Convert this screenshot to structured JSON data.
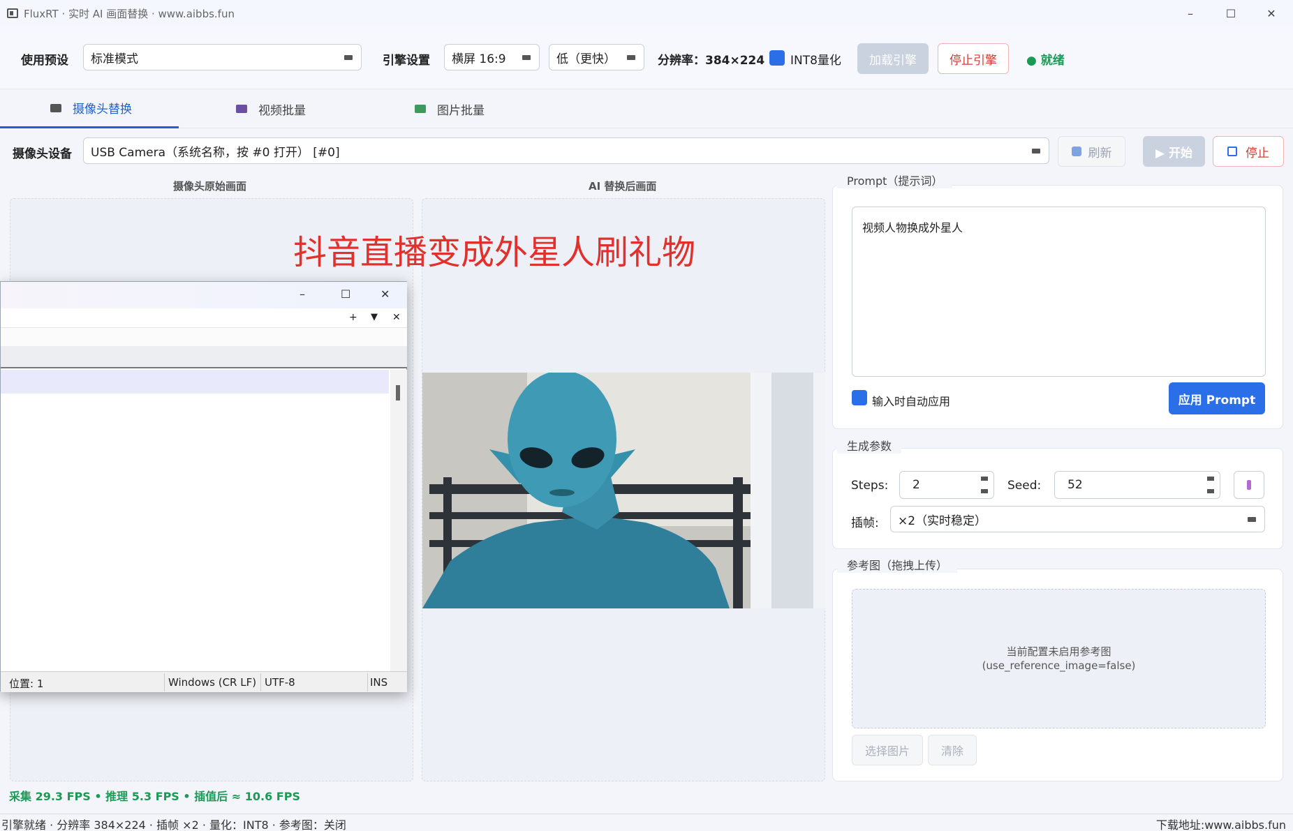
{
  "window": {
    "title": "FluxRT · 实时 AI 画面替换 · www.aibbs.fun",
    "minimize": "–",
    "maximize": "☐",
    "close": "✕"
  },
  "toolbar": {
    "preset_label": "使用预设",
    "preset_value": "标准模式",
    "engine_label": "引擎设置",
    "aspect_value": "横屏 16:9",
    "quality_value": "低（更快）",
    "resolution_text": "分辨率：384×224",
    "int8_label": "INT8量化",
    "load_engine": "加载引擎",
    "stop_engine": "停止引擎",
    "status": "● 就绪"
  },
  "tabs": [
    {
      "label": "摄像头替换"
    },
    {
      "label": "视频批量"
    },
    {
      "label": "图片批量"
    }
  ],
  "camera": {
    "device_label": "摄像头设备",
    "device_value": "USB Camera（系统名称，按 #0 打开）    [#0]",
    "refresh": "刷新",
    "start": "▶ 开始",
    "stop": "停止"
  },
  "preview": {
    "original_label": "摄像头原始画面",
    "ai_label": "AI 替换后画面",
    "overlay_caption": "抖音直播变成外星人刷礼物"
  },
  "prompt": {
    "group_title": "Prompt（提示词）",
    "text": "视频人物换成外星人",
    "auto_apply": "输入时自动应用",
    "apply_button": "应用 Prompt"
  },
  "params": {
    "group_title": "生成参数",
    "steps_label": "Steps:",
    "steps_value": "2",
    "seed_label": "Seed:",
    "seed_value": "52",
    "interp_label": "插帧:",
    "interp_value": "×2（实时稳定）"
  },
  "reference": {
    "group_title": "参考图（拖拽上传）",
    "empty_line1": "当前配置未启用参考图",
    "empty_line2": "(use_reference_image=false)",
    "choose": "选择图片",
    "clear": "清除"
  },
  "fps_text": "采集 29.3 FPS • 推理 5.3 FPS • 插值后 ≈ 10.6 FPS",
  "statusbar": {
    "left": "引擎就绪 · 分辨率 384×224 · 插帧 ×2 · 量化：INT8 · 参考图：关闭",
    "right": "下载地址:www.aibbs.fun"
  },
  "notepad": {
    "tab_plus": "+",
    "tab_down": "▼",
    "tab_close": "✕",
    "status_position": "位置: 1",
    "status_eol": "Windows (CR LF)",
    "status_encoding": "UTF-8",
    "status_mode": "INS"
  },
  "colors": {
    "accent": "#2a6fe8",
    "danger": "#e0312d",
    "ok": "#1a9a55"
  }
}
